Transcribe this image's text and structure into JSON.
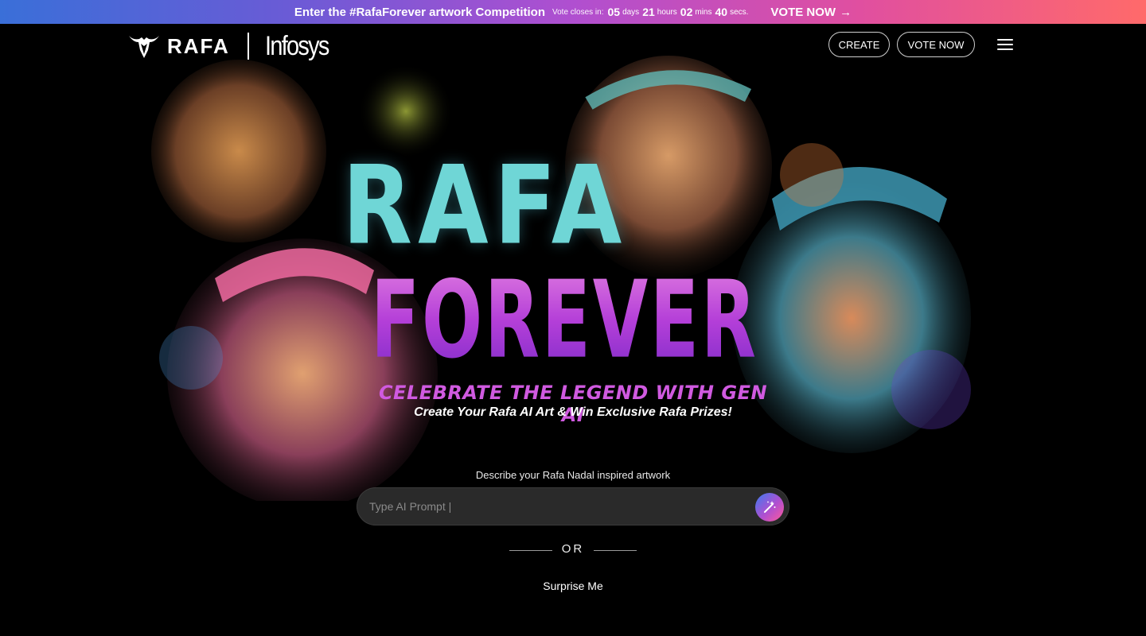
{
  "banner": {
    "title": "Enter the #RafaForever artwork Competition",
    "closes_label": "Vote closes in:",
    "countdown": [
      {
        "value": "05",
        "unit": "days"
      },
      {
        "value": "21",
        "unit": "hours"
      },
      {
        "value": "02",
        "unit": "mins"
      },
      {
        "value": "40",
        "unit": "secs."
      }
    ],
    "vote_link": "VOTE NOW",
    "vote_arrow": "→"
  },
  "header": {
    "logo_rafa": "RAFA",
    "logo_infosys": "Infosys",
    "create_label": "CREATE",
    "vote_label": "VOTE NOW",
    "menu_icon": "hamburger-icon"
  },
  "hero": {
    "word1": "RAFA",
    "word2": "FOREVER",
    "tagline": "CELEBRATE THE LEGEND WITH GEN AI",
    "subtagline": "Create Your Rafa AI Art & Win Exclusive Rafa Prizes!"
  },
  "prompt": {
    "label": "Describe your Rafa Nadal inspired artwork",
    "placeholder": "Type AI Prompt |",
    "value": "",
    "submit_icon": "magic-wand-icon"
  },
  "or_text": "OR",
  "surprise_label": "Surprise Me",
  "colors": {
    "banner_gradient": [
      "#3a6fd8",
      "#b04fd0",
      "#ff6a6a"
    ],
    "rafa_word": "#6fd6d6",
    "forever_word": "#b94bd9",
    "tagline": "#d05ae0",
    "background": "#000000"
  }
}
